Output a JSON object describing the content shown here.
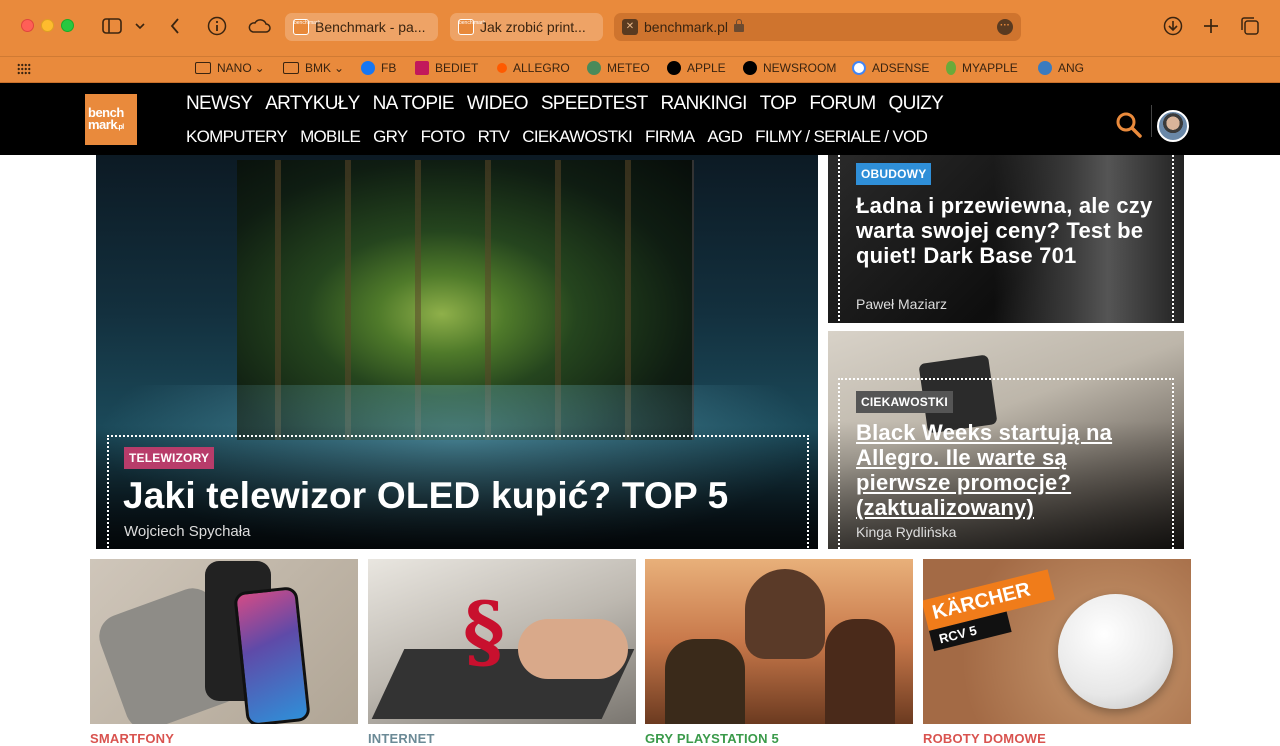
{
  "browser": {
    "tabs": [
      {
        "label": "Benchmark - pa..."
      },
      {
        "label": "Jak zrobić print..."
      },
      {
        "label": "benchmark.pl"
      }
    ],
    "icons": [
      "sidebar-icon",
      "chevron-down-icon",
      "back-icon",
      "info-icon",
      "cloud-icon",
      "download-icon",
      "plus-icon",
      "tabs-overview-icon"
    ],
    "bookmarks": [
      {
        "label": "NANO",
        "icon": "folder-icon",
        "color": "#3a2410"
      },
      {
        "label": "BMK",
        "icon": "folder-icon",
        "color": "#3a2410"
      },
      {
        "label": "FB",
        "icon": "facebook-icon",
        "color": "#1877f2"
      },
      {
        "label": "BEDIET",
        "icon": "bediet-icon",
        "color": "#c2185b"
      },
      {
        "label": "ALLEGRO",
        "icon": "allegro-icon",
        "color": "#ff5a00"
      },
      {
        "label": "METEO",
        "icon": "meteo-icon",
        "color": "#4a8a5a"
      },
      {
        "label": "APPLE",
        "icon": "apple-icon",
        "color": "#000000"
      },
      {
        "label": "NEWSROOM",
        "icon": "apple-icon",
        "color": "#000000"
      },
      {
        "label": "ADSENSE",
        "icon": "google-icon",
        "color": "#ffffff"
      },
      {
        "label": "MYAPPLE",
        "icon": "myapple-icon",
        "color": "#6aaa3a"
      },
      {
        "label": "ANG",
        "icon": "ang-icon",
        "color": "#3b7bbf"
      }
    ]
  },
  "site": {
    "logo": {
      "line1": "bench",
      "line2": "mark",
      "suffix": ".pl"
    },
    "nav_primary": [
      "NEWSY",
      "ARTYKUŁY",
      "NA TOPIE",
      "WIDEO",
      "SPEEDTEST",
      "RANKINGI",
      "TOP",
      "FORUM",
      "QUIZY"
    ],
    "nav_secondary": [
      "KOMPUTERY",
      "MOBILE",
      "GRY",
      "FOTO",
      "RTV",
      "CIEKAWOSTKI",
      "FIRMA",
      "AGD",
      "FILMY / SERIALE / VOD"
    ]
  },
  "hero": {
    "category": "TELEWIZORY",
    "category_color": "#b83c6a",
    "title": "Jaki telewizor OLED kupić? TOP 5",
    "author": "Wojciech Spychała"
  },
  "side_articles": [
    {
      "category": "OBUDOWY",
      "category_color": "#2f8fd8",
      "title": "Ładna i przewiewna, ale czy warta swojej ceny? Test be quiet! Dark Base 701",
      "author": "Paweł Maziarz"
    },
    {
      "category": "CIEKAWOSTKI",
      "category_color": "#555555",
      "title": "Black Weeks startują na Allegro. Ile warte są pierwsze promocje? (zaktualizowany)",
      "author": "Kinga Rydlińska"
    }
  ],
  "thumbs": [
    {
      "category": "SMARTFONY",
      "color": "#d9534f"
    },
    {
      "category": "INTERNET",
      "color": "#6b8a96"
    },
    {
      "category": "GRY PLAYSTATION 5",
      "color": "#3a9a4a"
    },
    {
      "category": "ROBOTY DOMOWE",
      "color": "#d9534f",
      "badge_line1": "KÄRCHER",
      "badge_line2": "RCV 5"
    }
  ]
}
